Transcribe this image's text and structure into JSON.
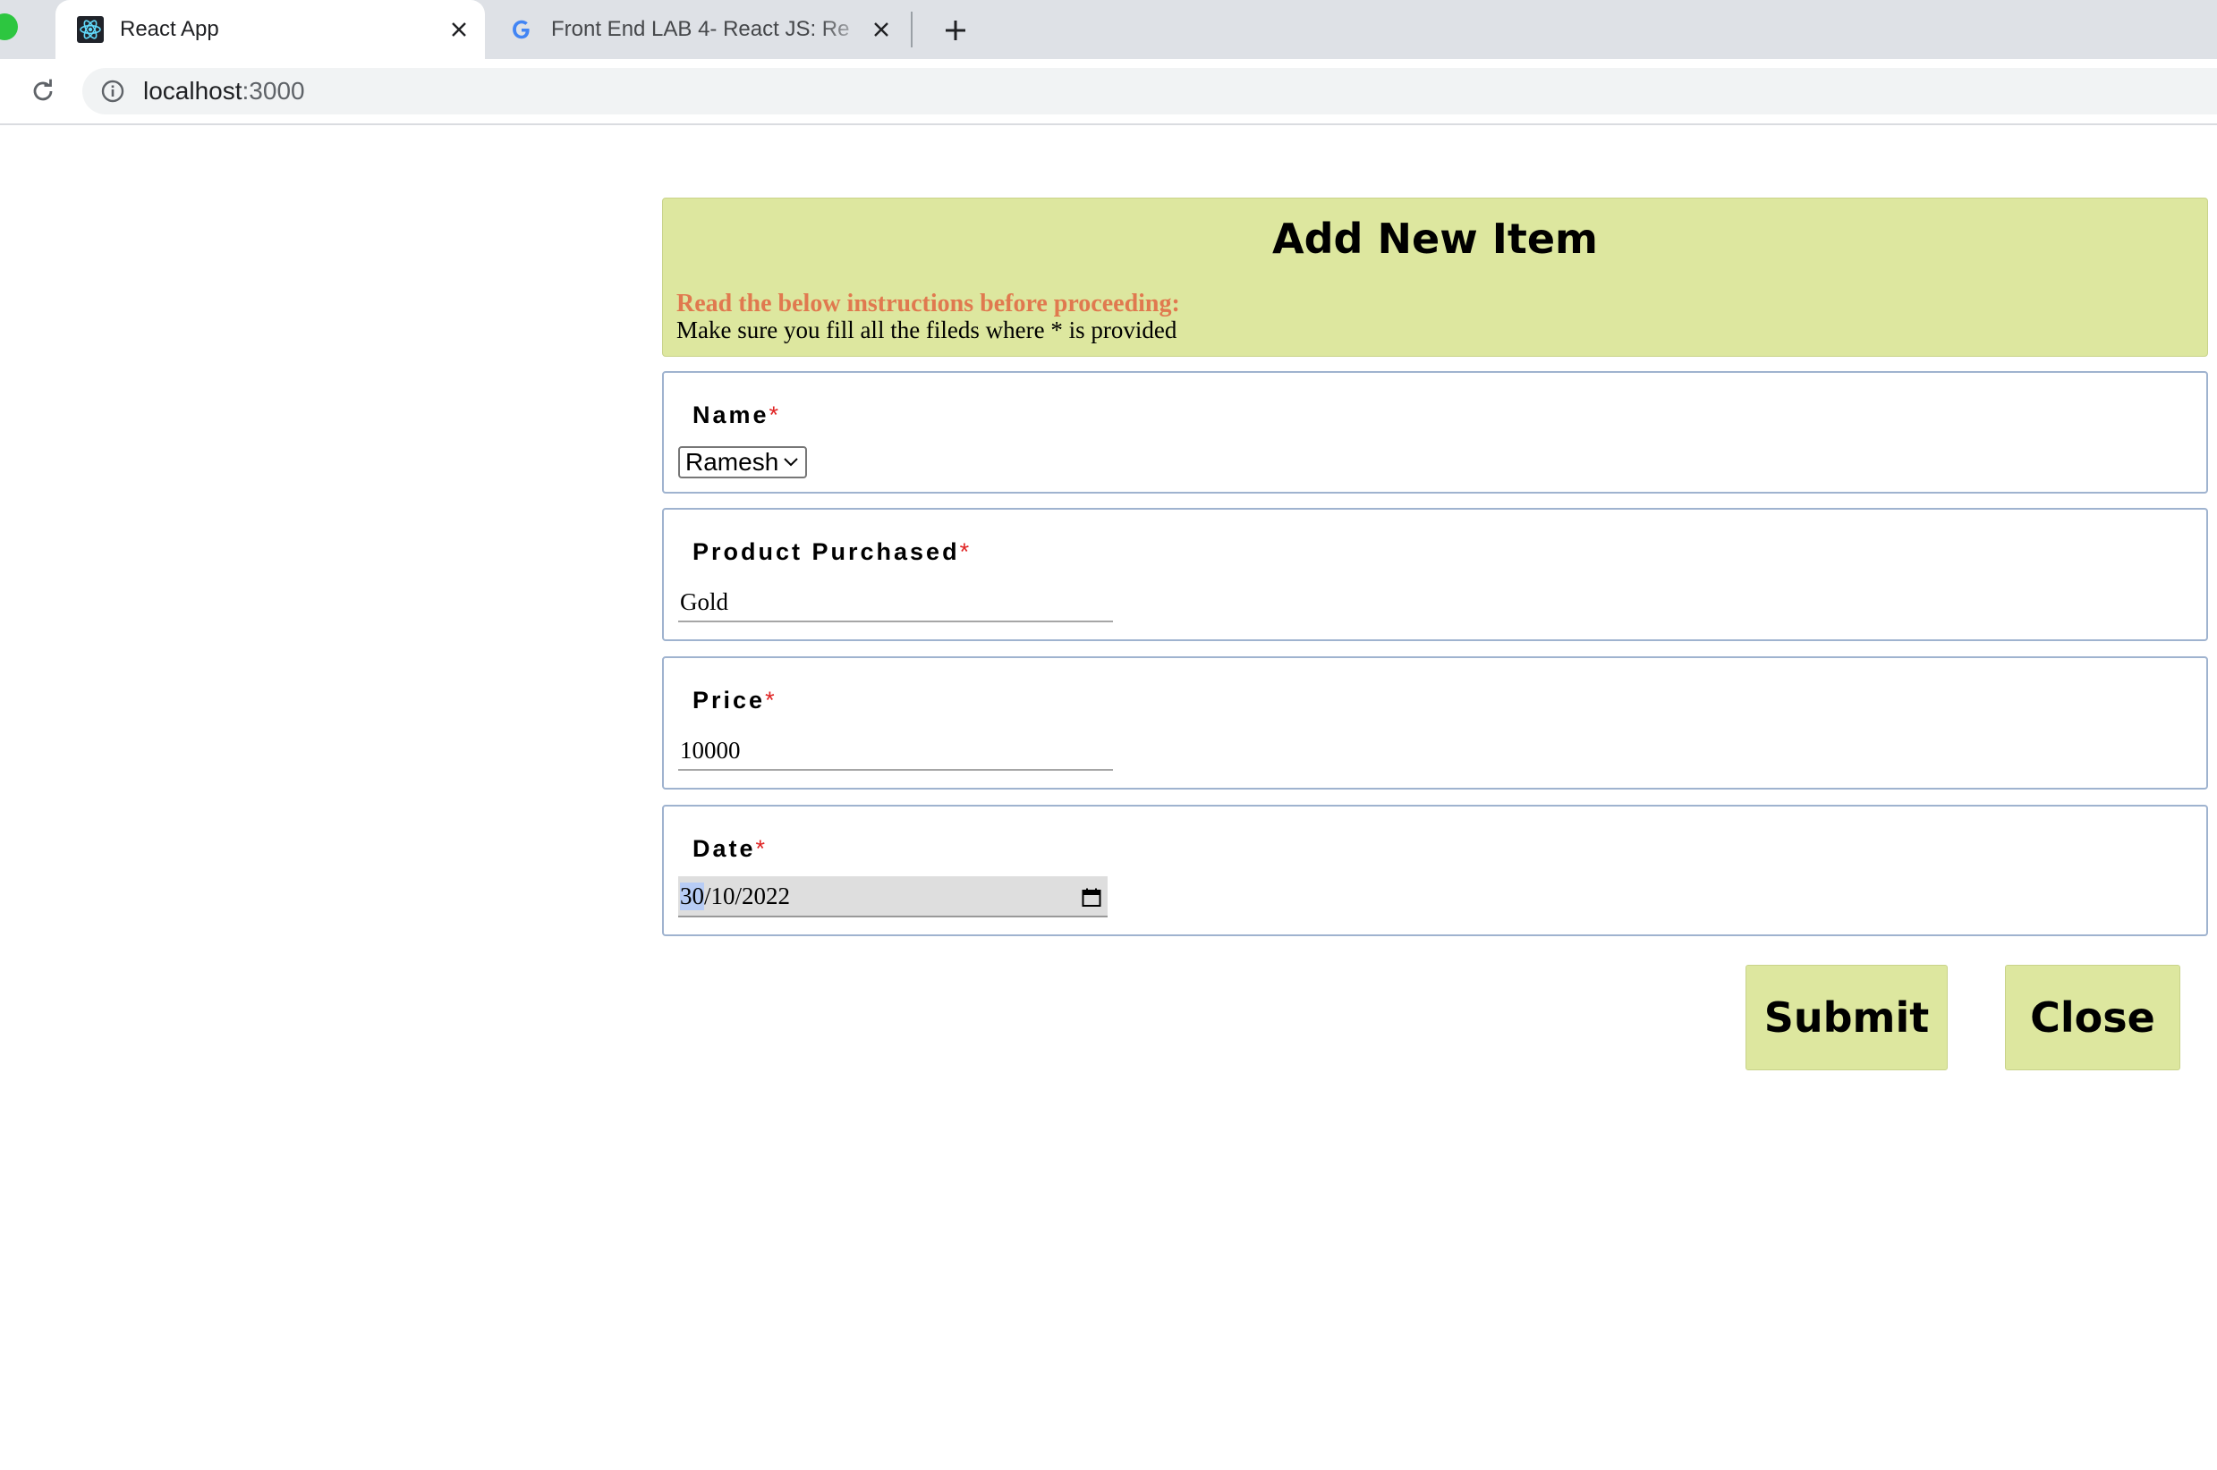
{
  "browser": {
    "tabs": [
      {
        "title": "React App",
        "active": true,
        "icon": "react-icon"
      },
      {
        "title": "Front End LAB 4- React JS: Re",
        "active": false,
        "icon": "google-icon"
      }
    ],
    "url_host": "localhost",
    "url_port": ":3000"
  },
  "form": {
    "title": "Add New Item",
    "instructions_title": "Read the below instructions before proceeding:",
    "instructions_body": "Make sure you fill all the fileds where * is provided",
    "required_mark": "*",
    "name": {
      "label": "Name",
      "value": "Ramesh"
    },
    "product": {
      "label": "Product Purchased",
      "value": "Gold"
    },
    "price": {
      "label": "Price",
      "value": "10000"
    },
    "date": {
      "label": "Date",
      "day": "30",
      "rest": "/10/2022"
    }
  },
  "buttons": {
    "submit": "Submit",
    "close": "Close"
  },
  "colors": {
    "panel": "#dde79f",
    "instructions_title": "#e0794f",
    "required": "#e02424",
    "field_border": "#9fb3cf"
  }
}
